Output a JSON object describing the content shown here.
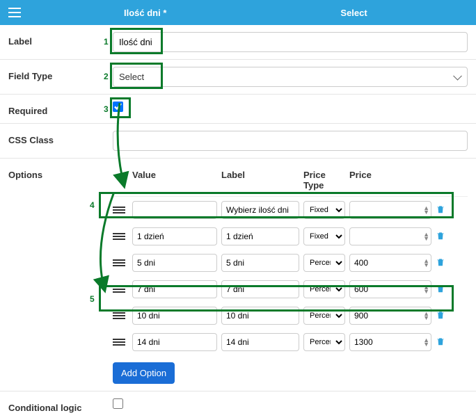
{
  "header": {
    "title": "Ilość dni *",
    "type": "Select"
  },
  "rows": {
    "label_label": "Label",
    "label_value": "Ilość dni",
    "fieldtype_label": "Field Type",
    "fieldtype_value": "Select",
    "required_label": "Required",
    "cssclass_label": "CSS Class",
    "cssclass_value": "",
    "options_label": "Options",
    "conditional_label": "Conditional logic"
  },
  "annotations": {
    "n1": "1",
    "n2": "2",
    "n3": "3",
    "n4": "4",
    "n5": "5"
  },
  "options_header": {
    "value": "Value",
    "label": "Label",
    "price_type": "Price Type",
    "price": "Price"
  },
  "options": [
    {
      "value": "",
      "label": "Wybierz ilość dni",
      "price_type": "Fixed",
      "price": ""
    },
    {
      "value": "1 dzień",
      "label": "1 dzień",
      "price_type": "Fixed",
      "price": ""
    },
    {
      "value": "5 dni",
      "label": "5 dni",
      "price_type": "Percent",
      "price": "400"
    },
    {
      "value": "7 dni",
      "label": "7 dni",
      "price_type": "Percent",
      "price": "600"
    },
    {
      "value": "10 dni",
      "label": "10 dni",
      "price_type": "Percent",
      "price": "900"
    },
    {
      "value": "14 dni",
      "label": "14 dni",
      "price_type": "Percent",
      "price": "1300"
    }
  ],
  "buttons": {
    "add_option": "Add Option"
  }
}
